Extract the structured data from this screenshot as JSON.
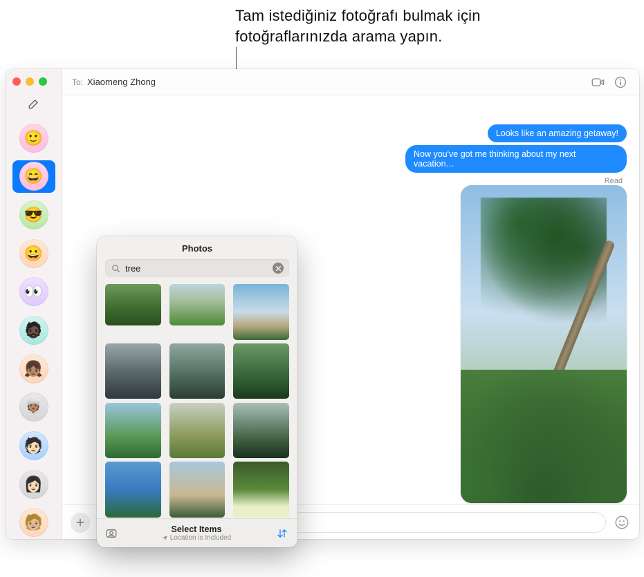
{
  "callout": "Tam istediğiniz fotoğrafı bulmak için fotoğraflarınızda arama yapın.",
  "header": {
    "to_label": "To:",
    "recipient": "Xiaomeng Zhong"
  },
  "messages": {
    "bubble1": "Looks like an amazing getaway!",
    "bubble2": "Now you've got me thinking about my next vacation…",
    "read": "Read"
  },
  "sidebar": {
    "conversations": [
      {
        "emoji": "🙂",
        "cls": "pink"
      },
      {
        "emoji": "😄",
        "cls": "pink",
        "selected": true
      },
      {
        "emoji": "😎",
        "cls": "green"
      },
      {
        "emoji": "😀",
        "cls": "peach"
      },
      {
        "emoji": "👀",
        "cls": "lav"
      },
      {
        "emoji": "🧔🏿",
        "cls": "teal"
      },
      {
        "emoji": "👧🏽",
        "cls": "peach"
      },
      {
        "emoji": "👳🏽",
        "cls": "gray"
      },
      {
        "emoji": "🧑🏻",
        "cls": "blue"
      },
      {
        "emoji": "👩🏻",
        "cls": "gray"
      },
      {
        "emoji": "🧑🏼",
        "cls": "peach"
      }
    ]
  },
  "photos_popover": {
    "title": "Photos",
    "search_value": "tree",
    "footer_title": "Select Items",
    "footer_sub": "Location is Included",
    "thumbs": [
      {
        "cls": "t-forest landscape"
      },
      {
        "cls": "t-meadow landscape"
      },
      {
        "cls": "t-palmbeach"
      },
      {
        "cls": "t-canyon"
      },
      {
        "cls": "t-river"
      },
      {
        "cls": "t-jungle"
      },
      {
        "cls": "t-palms"
      },
      {
        "cls": "t-dogfield"
      },
      {
        "cls": "t-path"
      },
      {
        "cls": "t-tropical"
      },
      {
        "cls": "t-beach"
      },
      {
        "cls": "t-flowers"
      }
    ]
  },
  "input": {
    "placeholder": ""
  }
}
